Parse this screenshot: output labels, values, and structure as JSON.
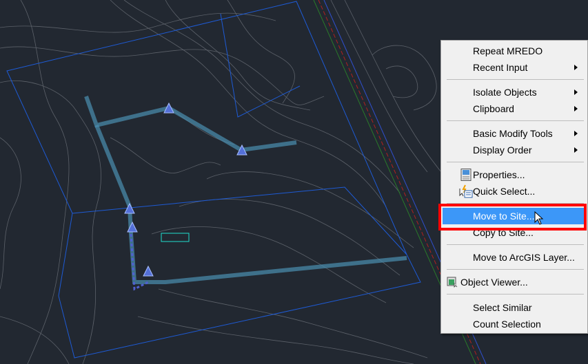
{
  "colors": {
    "background": "#222831",
    "contour": "#6b7078",
    "site_boundary": "#1e5bd6",
    "alignment": "#4a8fb0",
    "menu_highlight": "#3c97f8",
    "callout_box": "#ff0000"
  },
  "context_menu": {
    "groups": [
      [
        {
          "label": "Repeat MREDO"
        },
        {
          "label": "Recent Input",
          "submenu": true
        }
      ],
      [
        {
          "label": "Isolate Objects",
          "submenu": true
        },
        {
          "label": "Clipboard",
          "submenu": true
        }
      ],
      [
        {
          "label": "Basic Modify Tools",
          "submenu": true
        },
        {
          "label": "Display Order",
          "submenu": true
        }
      ],
      [
        {
          "label": "Properties...",
          "icon": "properties-icon"
        },
        {
          "label": "Quick Select...",
          "icon": "quick-select-icon"
        }
      ],
      [
        {
          "label": "Move to Site...",
          "highlighted": true
        },
        {
          "label": "Copy to Site..."
        }
      ],
      [
        {
          "label": "Move to ArcGIS Layer..."
        }
      ],
      [
        {
          "label": "Object Viewer...",
          "icon": "object-viewer-icon"
        }
      ],
      [
        {
          "label": "Select Similar"
        },
        {
          "label": "Count Selection"
        }
      ]
    ]
  }
}
